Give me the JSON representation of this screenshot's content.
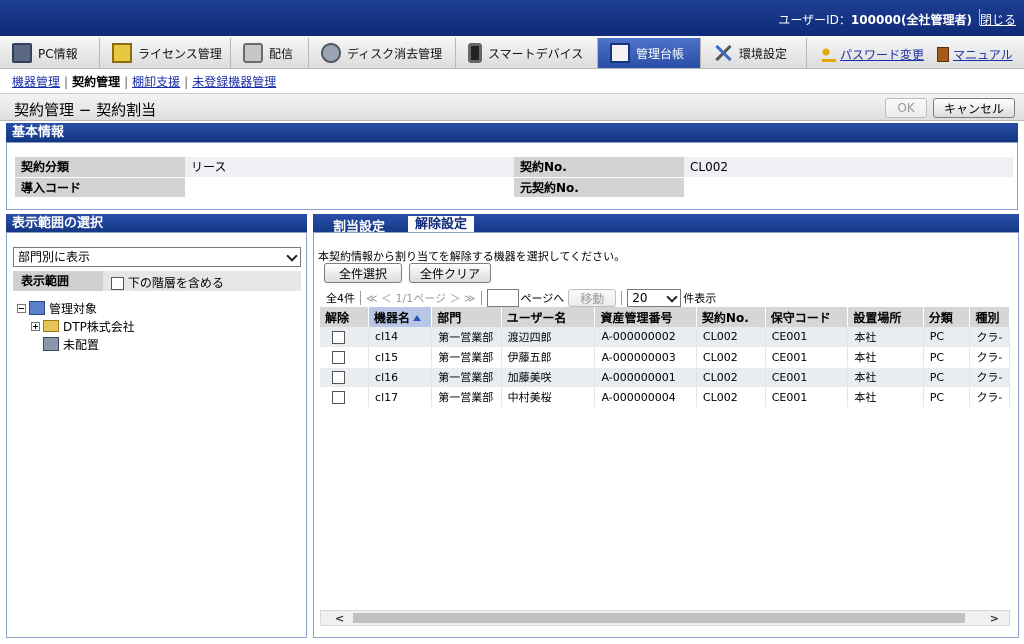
{
  "header": {
    "user_label": "ユーザーID：",
    "user_value": "100000(全社管理者)",
    "close_label": "閉じる"
  },
  "mainnav": {
    "tabs": [
      {
        "label": "PC情報",
        "icon": "pc-icon"
      },
      {
        "label": "ライセンス管理",
        "icon": "license-icon"
      },
      {
        "label": "配信",
        "icon": "delivery-icon"
      },
      {
        "label": "ディスク消去管理",
        "icon": "disk-erase-icon"
      },
      {
        "label": "スマートデバイス",
        "icon": "smartphone-icon"
      },
      {
        "label": "管理台帳",
        "icon": "ledger-icon",
        "active": true
      },
      {
        "label": "環境設定",
        "icon": "tools-icon"
      }
    ],
    "password_link": "パスワード変更",
    "manual_link": "マニュアル"
  },
  "subnav": {
    "items": [
      "機器管理",
      "契約管理",
      "棚卸支援",
      "未登録機器管理"
    ]
  },
  "page": {
    "title": "契約管理 − 契約割当",
    "ok_label": "OK",
    "cancel_label": "キャンセル"
  },
  "basic_info": {
    "title": "基本情報",
    "rows": [
      {
        "label1": "契約分類",
        "value1": "リース",
        "label2": "契約No.",
        "value2": "CL002"
      },
      {
        "label1": "導入コード",
        "value1": "",
        "label2": "元契約No.",
        "value2": ""
      }
    ]
  },
  "left_panel": {
    "title": "表示範囲の選択",
    "view_select": "部門別に表示",
    "scope_label": "表示範囲",
    "include_sub_label": "下の階層を含める",
    "tree": {
      "root": "管理対象",
      "child": "DTP株式会社",
      "unassigned": "未配置"
    }
  },
  "right_panel": {
    "tab_assign": "割当設定",
    "tab_release": "解除設定",
    "instruction": "本契約情報から割り当てを解除する機器を選択してください。",
    "select_all": "全件選択",
    "clear_all": "全件クリア",
    "pager": {
      "total": "全4件",
      "nav": "≪ ＜ 1/1ページ ＞ ≫",
      "page_suffix": "ページへ",
      "move_label": "移動",
      "per_page": "20",
      "per_page_suffix": "件表示"
    },
    "columns": [
      "解除",
      "機器名",
      "部門",
      "ユーザー名",
      "資産管理番号",
      "契約No.",
      "保守コード",
      "設置場所",
      "分類",
      "種別"
    ],
    "rows": [
      [
        "cl14",
        "第一営業部",
        "渡辺四郎",
        "A-000000002",
        "CL002",
        "CE001",
        "本社",
        "PC",
        "クラ-"
      ],
      [
        "cl15",
        "第一営業部",
        "伊藤五郎",
        "A-000000003",
        "CL002",
        "CE001",
        "本社",
        "PC",
        "クラ-"
      ],
      [
        "cl16",
        "第一営業部",
        "加藤美咲",
        "A-000000001",
        "CL002",
        "CE001",
        "本社",
        "PC",
        "クラ-"
      ],
      [
        "cl17",
        "第一営業部",
        "中村美桜",
        "A-000000004",
        "CL002",
        "CE001",
        "本社",
        "PC",
        "クラ-"
      ]
    ]
  }
}
